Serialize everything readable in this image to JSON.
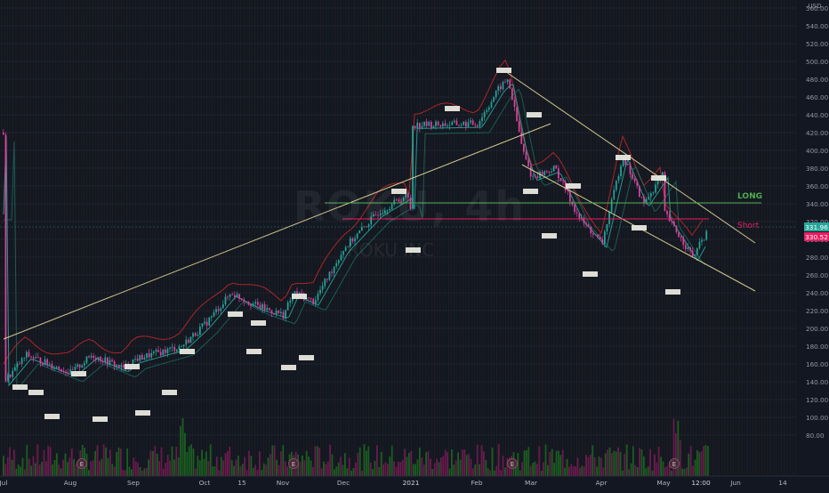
{
  "watermark": {
    "symbol": "ROKU, 4h",
    "name": "ROKU INC"
  },
  "axis": {
    "currency": "USD",
    "y_ticks": [
      80,
      100,
      120,
      140,
      160,
      180,
      200,
      220,
      240,
      260,
      280,
      300,
      320,
      340,
      360,
      380,
      400,
      420,
      440,
      460,
      480,
      500,
      520,
      540,
      560
    ],
    "x_ticks": [
      "Jul",
      "Aug",
      "Sep",
      "Oct",
      "15",
      "Nov",
      "Dec",
      "2021",
      "Feb",
      "Mar",
      "Apr",
      "May",
      "12:00",
      "Jun",
      "14"
    ]
  },
  "price_labels": {
    "upper": {
      "value": "331.96",
      "color": "#26a69a"
    },
    "lower": {
      "value": "330.52",
      "color": "#e91e63"
    }
  },
  "levels": {
    "long": {
      "label": "LONG",
      "price": 341,
      "color": "#4caf50"
    },
    "short": {
      "label": "Short",
      "price": 323,
      "color": "#e91e63"
    }
  },
  "colors": {
    "background": "#131722",
    "up_candle": "#26a69a",
    "down_candle": "#e040a0",
    "trendline": "#f0e6a0",
    "upper_band": "#c62828",
    "ema": "#26a69a",
    "volume_up": "#1b5e20",
    "volume_down": "#6a1b4d"
  },
  "chart_data": {
    "type": "candlestick",
    "title": "",
    "interval": "4h",
    "ylim": [
      77,
      566
    ],
    "y_scale": "linear",
    "price_path": [
      {
        "x": "Jul",
        "y": 140
      },
      {
        "x": "Jul 10",
        "y": 170
      },
      {
        "x": "Jul 25",
        "y": 155
      },
      {
        "x": "Aug",
        "y": 150
      },
      {
        "x": "Aug 10",
        "y": 170
      },
      {
        "x": "Aug 25",
        "y": 155
      },
      {
        "x": "Sep",
        "y": 165
      },
      {
        "x": "Sep 20",
        "y": 180
      },
      {
        "x": "Oct",
        "y": 205
      },
      {
        "x": "Oct 10",
        "y": 240
      },
      {
        "x": "Oct 20",
        "y": 225
      },
      {
        "x": "Nov",
        "y": 215
      },
      {
        "x": "Nov 5",
        "y": 240
      },
      {
        "x": "Nov 15",
        "y": 230
      },
      {
        "x": "Dec",
        "y": 290
      },
      {
        "x": "Dec 15",
        "y": 330
      },
      {
        "x": "Dec 28",
        "y": 350
      },
      {
        "x": "2021",
        "y": 330
      },
      {
        "x": "Jan 15",
        "y": 420
      },
      {
        "x": "Feb",
        "y": 430
      },
      {
        "x": "Feb 12",
        "y": 470
      },
      {
        "x": "Feb 17",
        "y": 480
      },
      {
        "x": "Feb 25",
        "y": 400
      },
      {
        "x": "Mar",
        "y": 370
      },
      {
        "x": "Mar 10",
        "y": 380
      },
      {
        "x": "Mar 20",
        "y": 325
      },
      {
        "x": "Apr",
        "y": 295
      },
      {
        "x": "Apr 10",
        "y": 395
      },
      {
        "x": "Apr 20",
        "y": 340
      },
      {
        "x": "Apr 30",
        "y": 375
      },
      {
        "x": "May",
        "y": 330
      },
      {
        "x": "May 12",
        "y": 280
      },
      {
        "x": "May 20",
        "y": 320
      },
      {
        "x": "May 28",
        "y": 332
      }
    ],
    "lines": [
      {
        "name": "",
        "kind": "trendline",
        "points": [
          [
            "Jul",
            188
          ],
          [
            "Mar",
            430
          ]
        ]
      },
      {
        "name": "",
        "kind": "trendline",
        "points": [
          [
            "Feb 17",
            487
          ],
          [
            "Jun",
            296
          ]
        ]
      },
      {
        "name": "",
        "kind": "trendline",
        "points": [
          [
            "Feb 25",
            384
          ],
          [
            "Jun",
            242
          ]
        ]
      }
    ],
    "annotations": [
      {
        "label": "LONG",
        "price": 341
      },
      {
        "label": "Short",
        "price": 323
      }
    ],
    "earnings_markers": [
      "Aug",
      "Nov",
      "Feb",
      "May"
    ],
    "grid": true,
    "legend": "none"
  }
}
